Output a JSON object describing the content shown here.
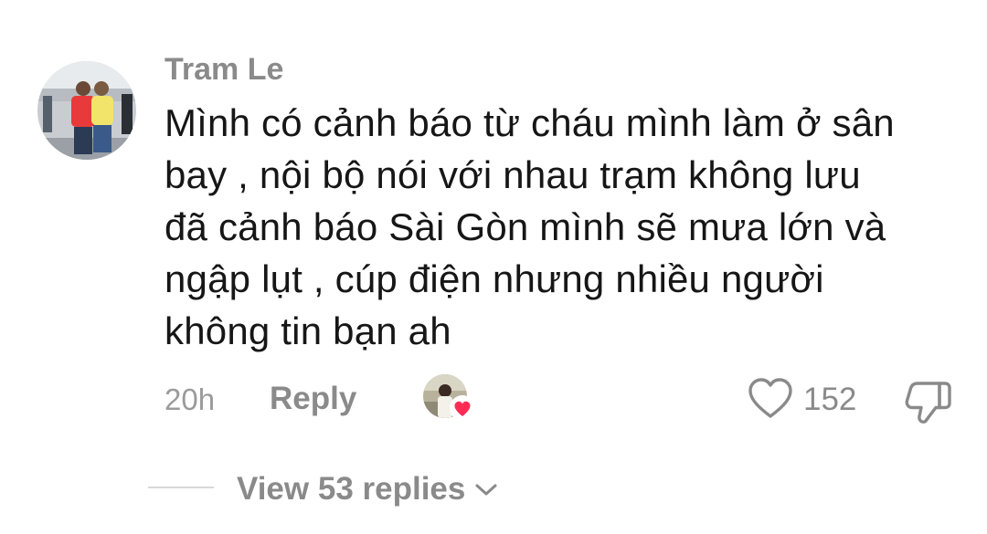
{
  "comment": {
    "author": "Tram Le",
    "avatar": "profile-photo-two-people-airport",
    "text_lines": [
      "Mình có cảnh báo từ cháu mình làm ở sân",
      "bay , nội bộ nói với nhau trạm không lưu",
      "đã cảnh báo Sài Gòn mình sẽ mưa lớn và",
      "ngập lụt , cúp điện nhưng nhiều người",
      "không tin bạn ah"
    ],
    "timestamp": "20h",
    "reply_label": "Reply",
    "creator_liked_icon": "heart-icon",
    "like_icon": "heart-outline-icon",
    "like_count": "152",
    "dislike_icon": "thumbs-down-outline-icon"
  },
  "replies": {
    "view_label": "View 53 replies",
    "icon": "chevron-down-icon"
  },
  "colors": {
    "text_primary": "#161616",
    "text_secondary": "#8a8a8a",
    "heart_badge": "#fe2c55",
    "divider": "#d8d8d8"
  }
}
